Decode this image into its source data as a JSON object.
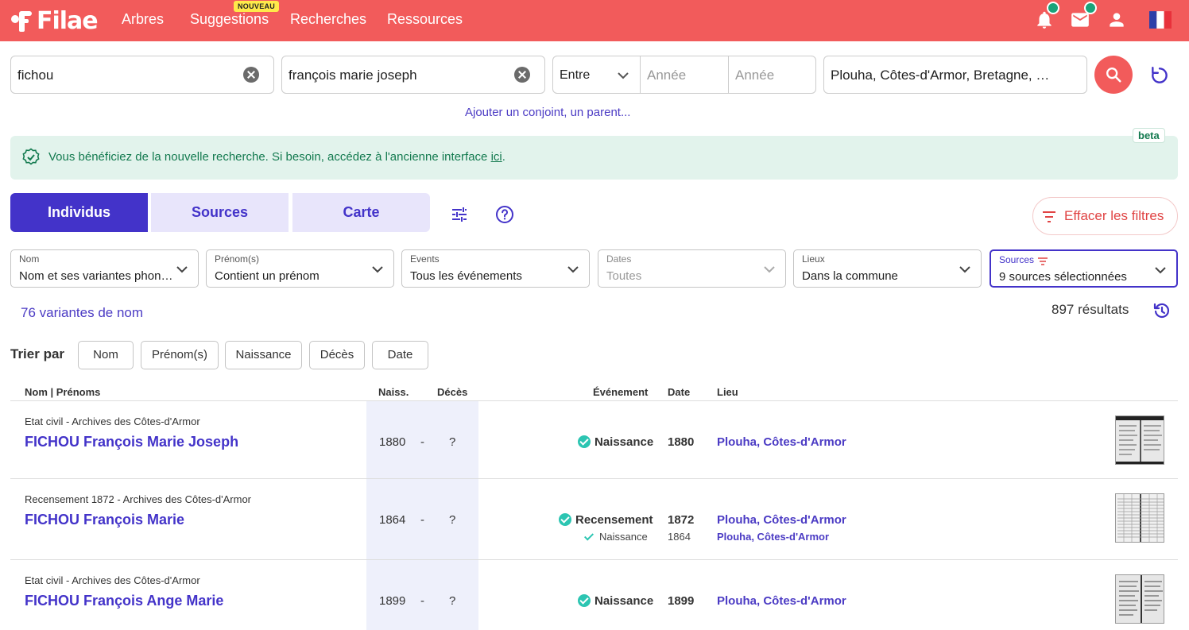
{
  "nav": {
    "logo": "Filae",
    "items": [
      "Arbres",
      "Suggestions",
      "Recherches",
      "Ressources"
    ],
    "badge_new": "NOUVEAU"
  },
  "search": {
    "surname": "fichou",
    "firstname": "françois marie joseph",
    "range_mode": "Entre",
    "year_from_placeholder": "Année",
    "year_to_placeholder": "Année",
    "place": "Plouha, Côtes-d'Armor, Bretagne, …",
    "add_relative": "Ajouter un conjoint, un parent..."
  },
  "banner": {
    "text": "Vous bénéficiez de la nouvelle recherche. Si besoin, accédez à l'ancienne interface ",
    "link": "ici",
    "end": ".",
    "beta": "beta"
  },
  "tabs": [
    "Individus",
    "Sources",
    "Carte"
  ],
  "clear_filters": "Effacer les filtres",
  "filters": [
    {
      "label": "Nom",
      "value": "Nom et ses variantes phoné…"
    },
    {
      "label": "Prénom(s)",
      "value": "Contient un prénom"
    },
    {
      "label": "Events",
      "value": "Tous les événements"
    },
    {
      "label": "Dates",
      "value": "Toutes"
    },
    {
      "label": "Lieux",
      "value": "Dans la commune"
    },
    {
      "label": "Sources",
      "value": "9 sources sélectionnées"
    }
  ],
  "variants": "76 variantes de nom",
  "results": "897 résultats",
  "sort": {
    "label": "Trier par",
    "options": [
      "Nom",
      "Prénom(s)",
      "Naissance",
      "Décès",
      "Date"
    ]
  },
  "table": {
    "headers": [
      "Nom | Prénoms",
      "Naiss.",
      "Décès",
      "Événement",
      "Date",
      "Lieu"
    ],
    "rows": [
      {
        "source": "Etat civil - Archives des Côtes-d'Armor",
        "name": "FICHOU François Marie Joseph",
        "birth": "1880",
        "sep": "-",
        "death": "?",
        "event": "Naissance",
        "date": "1880",
        "place": "Plouha, Côtes-d'Armor"
      },
      {
        "source": "Recensement 1872 - Archives des Côtes-d'Armor",
        "name": "FICHOU François Marie",
        "birth": "1864",
        "sep": "-",
        "death": "?",
        "event": "Recensement",
        "date": "1872",
        "place": "Plouha, Côtes-d'Armor",
        "event2": "Naissance",
        "date2": "1864",
        "place2": "Plouha, Côtes-d'Armor"
      },
      {
        "source": "Etat civil - Archives des Côtes-d'Armor",
        "name": "FICHOU François Ange Marie",
        "birth": "1899",
        "sep": "-",
        "death": "?",
        "event": "Naissance",
        "date": "1899",
        "place": "Plouha, Côtes-d'Armor"
      }
    ]
  },
  "colors": {
    "brand": "#f25b5b",
    "accent": "#4333c9",
    "success": "#137a4f",
    "check": "#2cc5b2"
  }
}
